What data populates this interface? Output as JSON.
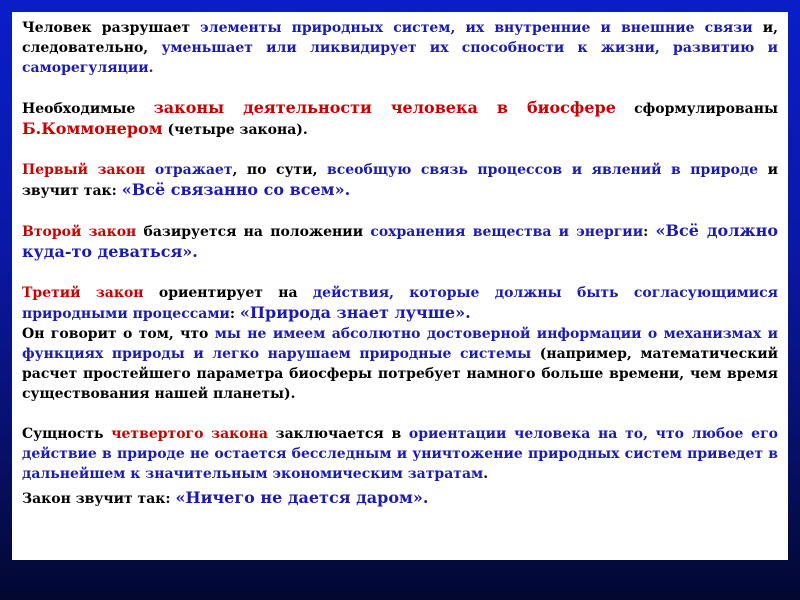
{
  "p1": {
    "a": "Человек разрушает ",
    "b": "элементы природных систем, их внутренние и внешние связи",
    "c": " и, следовательно, ",
    "d": "уменьшает или ликвидирует их способности к жизни, развитию и саморегуляции."
  },
  "p2": {
    "a": "Необходимые ",
    "b": "законы деятельности человека в биосфере",
    "c": " сформулированы ",
    "d": "Б.Коммонером",
    "e": " (четыре закона)."
  },
  "p3": {
    "a": "Первый закон",
    "b": " отражает",
    "c": ", по сути, ",
    "d": "всеобщую связь процессов и явлений в природе",
    "e": " и звучит так: ",
    "f": "«Всё связанно со всем»."
  },
  "p4": {
    "a": "Второй закон",
    "b": " базируется на положении ",
    "c": "сохранения вещества и энергии",
    "d": ": ",
    "e": "«Всё должно куда-то деваться»."
  },
  "p5": {
    "a": "Третий закон",
    "b": " ориентирует на ",
    "c": "действия, которые должны быть согласующимися природными процессами",
    "d": ": ",
    "e": "«Природа знает лучше»."
  },
  "p6": {
    "a": "Он говорит о том, что  ",
    "b": "мы не имеем абсолютно достоверной информации о механизмах и функциях природы и легко нарушаем природные системы",
    "c": " (например, математический расчет простейшего параметра биосферы потребует намного больше времени, чем время существования нашей планеты)."
  },
  "p7": {
    "a": "Сущность ",
    "b": "четвертого закона",
    "c": " заключается в ",
    "d": "ориентации человека на то, что любое его действие в природе не остается бесследным и уничтожение природных систем приведет в дальнейшем к значительным экономическим затратам",
    "e": "."
  },
  "p8": {
    "a": "Закон звучит так: ",
    "b": "«Ничего не дается даром»."
  }
}
